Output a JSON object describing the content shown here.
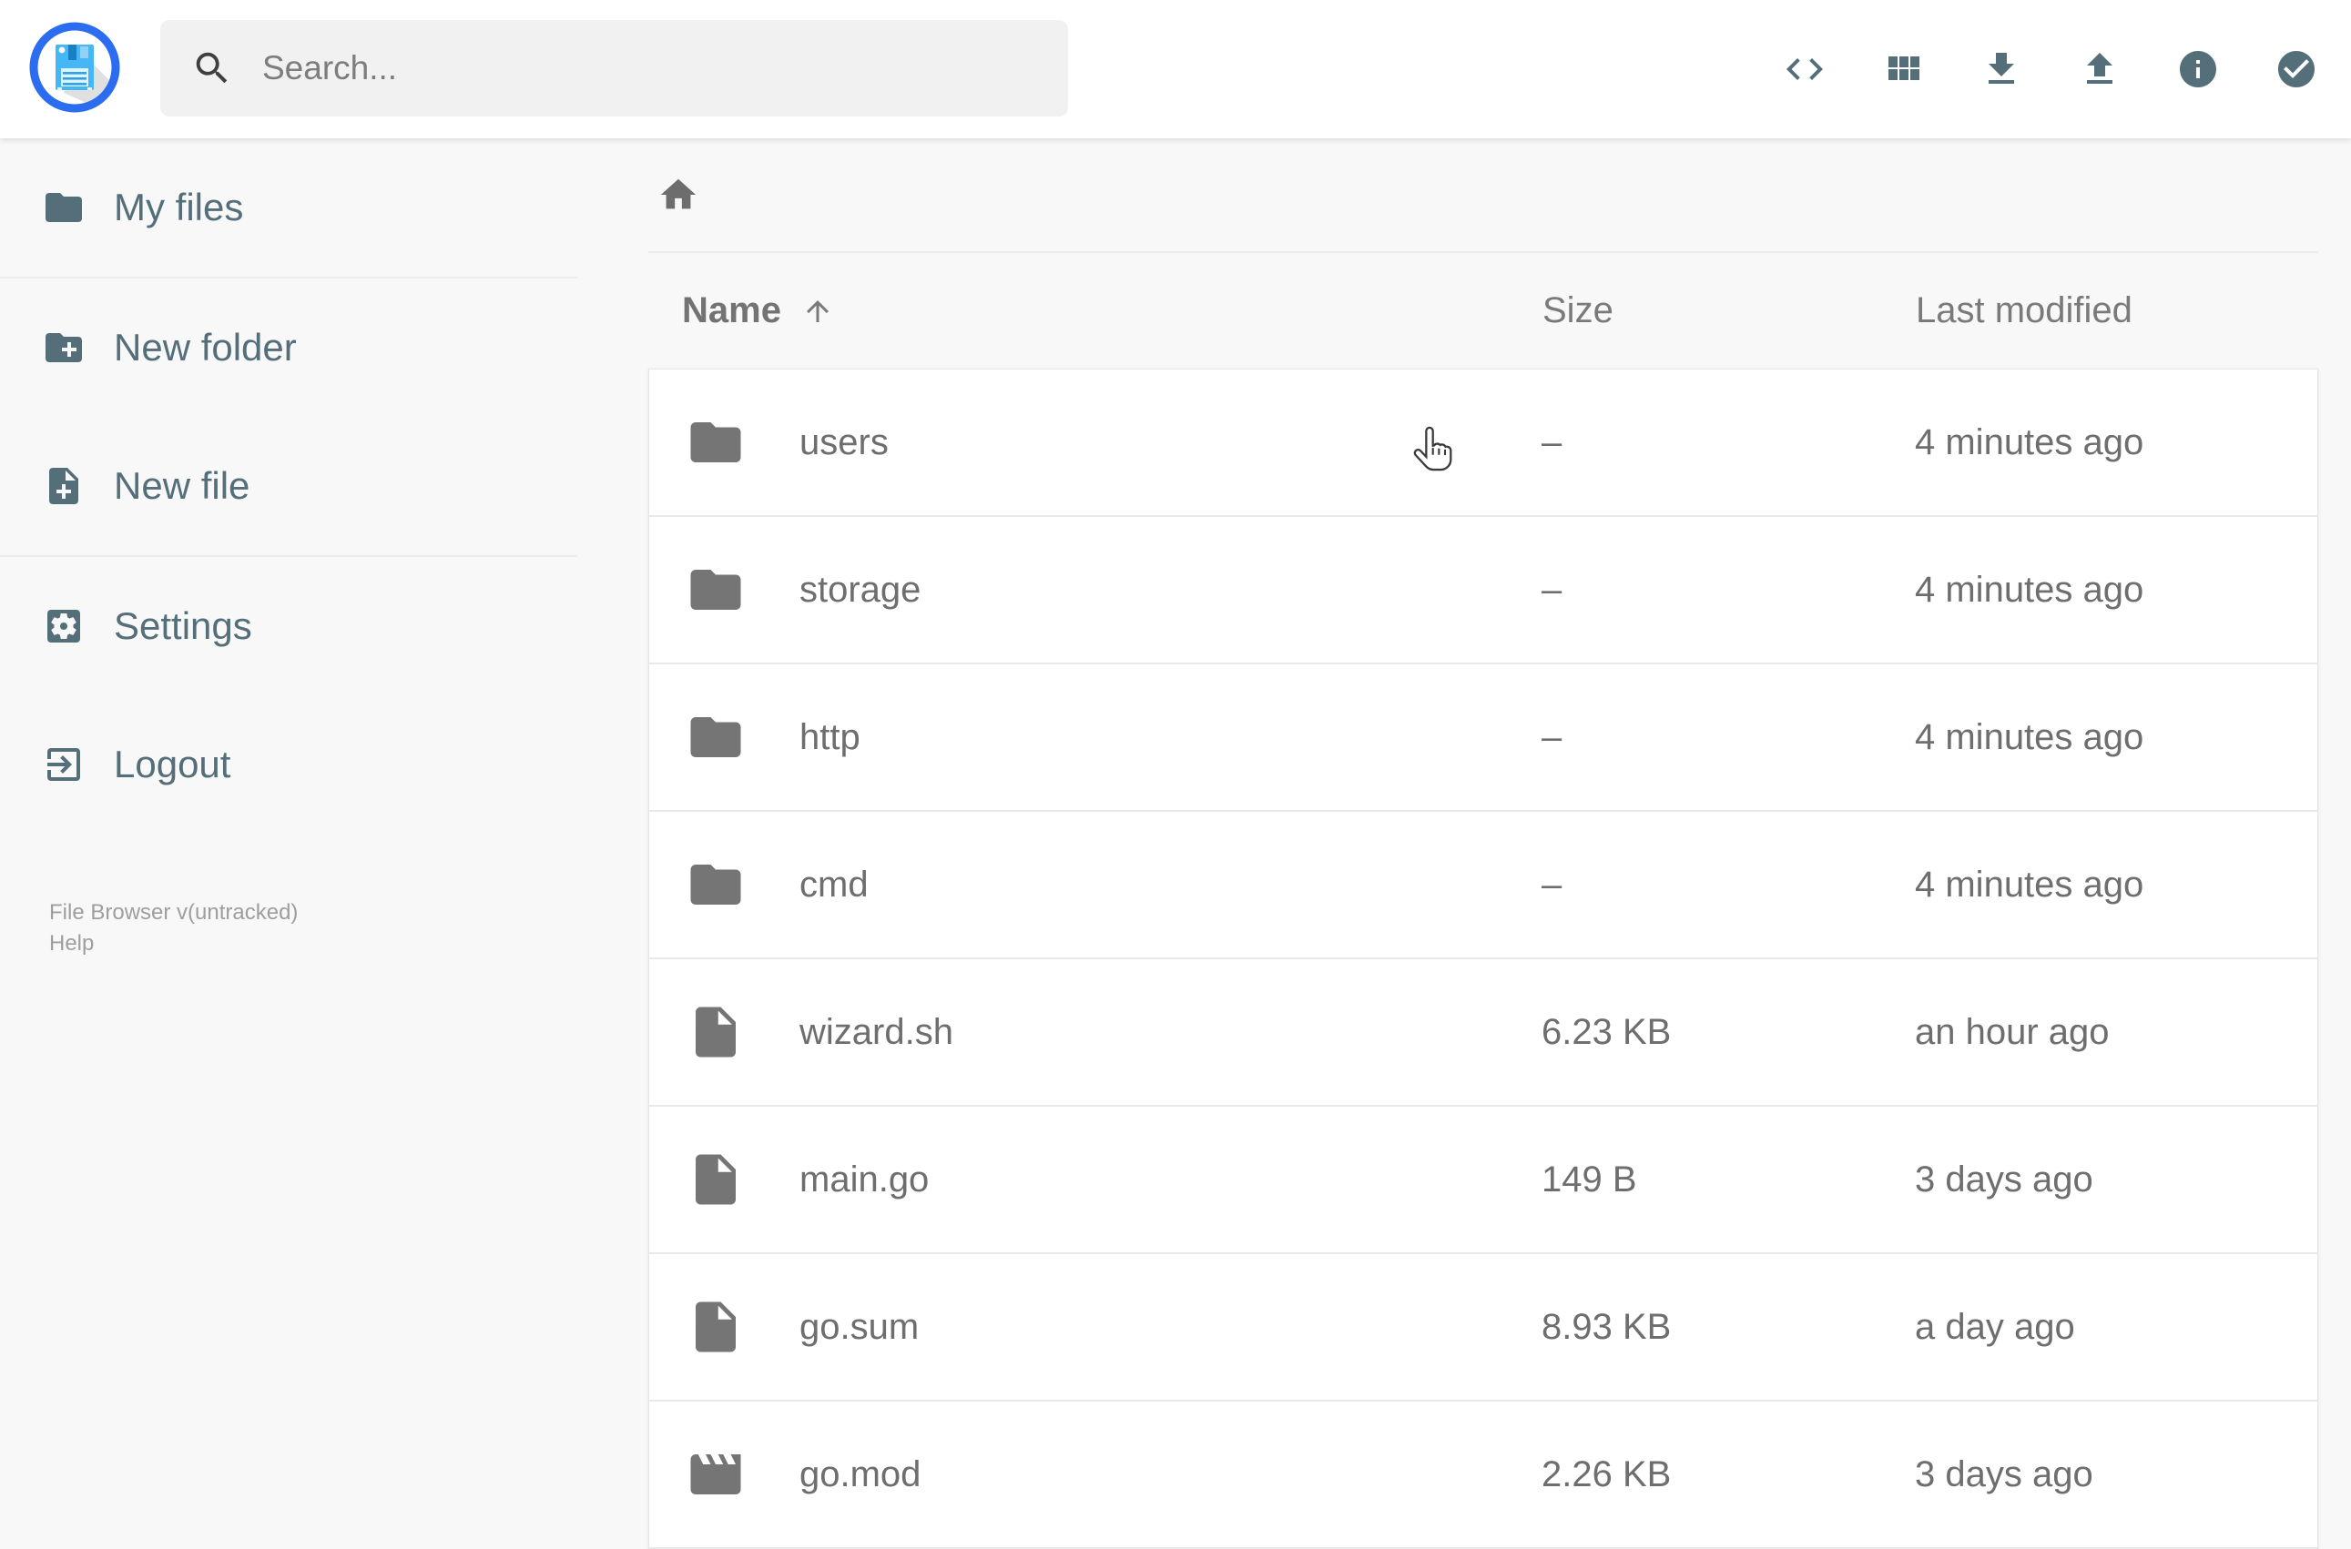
{
  "app": {
    "name": "File Browser",
    "colors": {
      "accent_slate": "#546e7a",
      "logo_blue": "#2b6cf0",
      "floppy_blue": "#45b7f4",
      "row_gray": "#6e6e6e",
      "background": "#f8f8f8",
      "card_white": "#ffffff"
    }
  },
  "header": {
    "logo_icon": "floppy-disk-logo",
    "search": {
      "placeholder": "Search...",
      "value": "",
      "icon": "search-icon"
    },
    "action_icons": [
      "code-icon",
      "grid-view-icon",
      "download-icon",
      "upload-icon",
      "info-icon",
      "check-circle-icon"
    ]
  },
  "sidebar": {
    "items": [
      {
        "label": "My files",
        "icon": "folder-icon"
      },
      {
        "label": "New folder",
        "icon": "create-new-folder-icon"
      },
      {
        "label": "New file",
        "icon": "note-add-icon"
      },
      {
        "label": "Settings",
        "icon": "settings-icon"
      },
      {
        "label": "Logout",
        "icon": "logout-icon"
      }
    ],
    "footer": {
      "version": "File Browser v(untracked)",
      "help": "Help"
    }
  },
  "main": {
    "breadcrumb_icon": "home-icon",
    "columns": {
      "name": "Name",
      "size": "Size",
      "modified": "Last modified"
    },
    "sort": {
      "column": "name",
      "direction": "asc"
    },
    "rows": [
      {
        "icon": "folder",
        "name": "users",
        "size": "–",
        "modified": "4 minutes ago"
      },
      {
        "icon": "folder",
        "name": "storage",
        "size": "–",
        "modified": "4 minutes ago"
      },
      {
        "icon": "folder",
        "name": "http",
        "size": "–",
        "modified": "4 minutes ago"
      },
      {
        "icon": "folder",
        "name": "cmd",
        "size": "–",
        "modified": "4 minutes ago"
      },
      {
        "icon": "file",
        "name": "wizard.sh",
        "size": "6.23 KB",
        "modified": "an hour ago"
      },
      {
        "icon": "file",
        "name": "main.go",
        "size": "149 B",
        "modified": "3 days ago"
      },
      {
        "icon": "file",
        "name": "go.sum",
        "size": "8.93 KB",
        "modified": "a day ago"
      },
      {
        "icon": "movie",
        "name": "go.mod",
        "size": "2.26 KB",
        "modified": "3 days ago"
      }
    ]
  }
}
